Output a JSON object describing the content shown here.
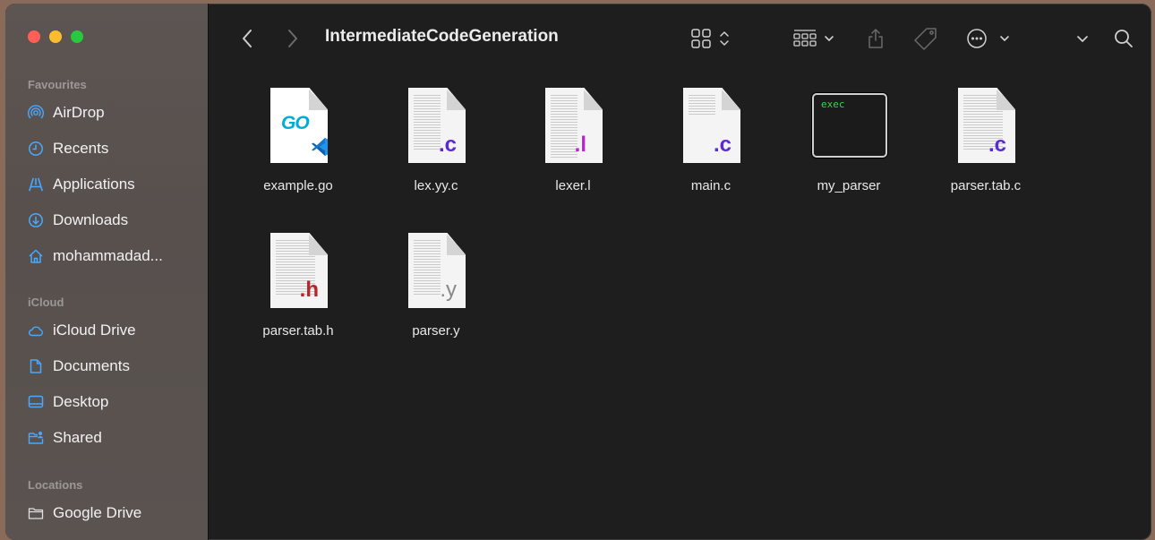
{
  "window": {
    "title": "IntermediateCodeGeneration"
  },
  "sidebar": {
    "favourites_title": "Favourites",
    "favourites": [
      {
        "label": "AirDrop",
        "icon": "airdrop-icon"
      },
      {
        "label": "Recents",
        "icon": "clock-icon"
      },
      {
        "label": "Applications",
        "icon": "applications-icon"
      },
      {
        "label": "Downloads",
        "icon": "download-icon"
      },
      {
        "label": "mohammadad...",
        "icon": "home-icon"
      }
    ],
    "icloud_title": "iCloud",
    "icloud": [
      {
        "label": "iCloud Drive",
        "icon": "cloud-icon"
      },
      {
        "label": "Documents",
        "icon": "document-icon"
      },
      {
        "label": "Desktop",
        "icon": "desktop-icon"
      },
      {
        "label": "Shared",
        "icon": "shared-folder-icon"
      }
    ],
    "locations_title": "Locations",
    "locations": [
      {
        "label": "Google Drive",
        "icon": "drive-icon"
      }
    ]
  },
  "files": [
    {
      "name": "example.go",
      "type": "go",
      "ext": "GO"
    },
    {
      "name": "lex.yy.c",
      "type": "doc",
      "ext": ".c",
      "ext_color": "#5a2bd0"
    },
    {
      "name": "lexer.l",
      "type": "doc",
      "ext": ".l",
      "ext_color": "#b02bc8"
    },
    {
      "name": "main.c",
      "type": "doc",
      "ext": ".c",
      "ext_color": "#5a2bd0"
    },
    {
      "name": "my_parser",
      "type": "exec",
      "ext": "exec"
    },
    {
      "name": "parser.tab.c",
      "type": "doc",
      "ext": ".c",
      "ext_color": "#5a2bd0"
    },
    {
      "name": "parser.tab.h",
      "type": "doc",
      "ext": ".h",
      "ext_color": "#b3262a"
    },
    {
      "name": "parser.y",
      "type": "doc",
      "ext": ".y",
      "ext_color": "#888888"
    }
  ],
  "colors": {
    "accent": "#4aa8ff",
    "exec_text": "#37d74a"
  }
}
